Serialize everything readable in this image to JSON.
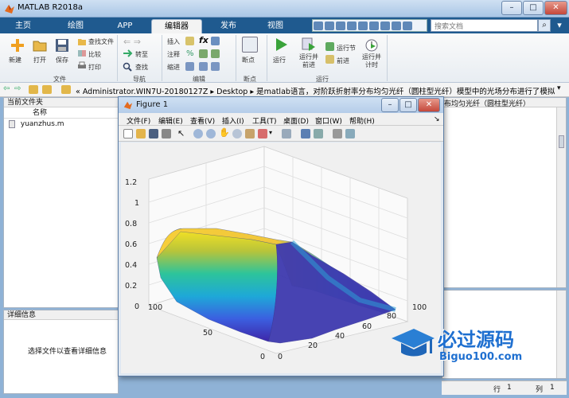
{
  "app": {
    "title": "MATLAB R2018a",
    "window_controls": {
      "minimize": "–",
      "maximize": "□",
      "close": "✕"
    }
  },
  "tabs": [
    {
      "label": "主页"
    },
    {
      "label": "绘图"
    },
    {
      "label": "APP"
    },
    {
      "label": "编辑器",
      "active": true
    },
    {
      "label": "发布"
    },
    {
      "label": "视图"
    }
  ],
  "search": {
    "placeholder": "搜索文档"
  },
  "ribbon": {
    "file_group": "文件",
    "nav_group": "导航",
    "edit_group": "编辑",
    "breakpoint_group": "断点",
    "run_group": "运行",
    "buttons": {
      "new": "新建",
      "open": "打开",
      "save": "保存",
      "find_files": "查找文件",
      "compare": "比较",
      "print": "打印",
      "goto": "转至",
      "find": "查找",
      "insert": "插入",
      "comment": "注释",
      "indent": "缩进",
      "breakpoints": "断点",
      "run": "运行",
      "run_advance": "运行并\n前进",
      "run_section": "运行节",
      "advance": "前进",
      "run_time": "运行并\n计时"
    }
  },
  "address": {
    "path": "« Administrator.WIN7U-20180127Z ▸ Desktop ▸ 是matlab语言，对阶跃折射率分布均匀光纤（圆柱型光纤）模型中的光场分布进行了模拟",
    "editor_tab": "布均匀光纤（圆柱型光纤）"
  },
  "file_panel": {
    "title": "当前文件夹",
    "name_header": "名称",
    "files": [
      "yuanzhus.m"
    ]
  },
  "detail_panel": {
    "title": "详细信息",
    "hint": "选择文件以查看详细信息"
  },
  "status": {
    "row_label": "行",
    "row": "1",
    "col_label": "列",
    "col": "1"
  },
  "figure": {
    "title": "Figure 1",
    "menus": [
      "文件(F)",
      "编辑(E)",
      "查看(V)",
      "插入(I)",
      "工具(T)",
      "桌面(D)",
      "窗口(W)",
      "帮助(H)"
    ]
  },
  "chart_data": {
    "type": "surface",
    "title": "",
    "xlabel": "",
    "ylabel": "",
    "zlabel": "",
    "x_range": [
      0,
      100
    ],
    "y_range": [
      0,
      100
    ],
    "zlim": [
      0,
      1.2
    ],
    "x_ticks": [
      0,
      20,
      40,
      60,
      80,
      100
    ],
    "y_ticks": [
      0,
      50,
      100
    ],
    "z_ticks": [
      0,
      0.2,
      0.4,
      0.6,
      0.8,
      1,
      1.2
    ],
    "colormap": "parula",
    "grid": true,
    "profile_along_x": [
      {
        "x": 0,
        "z": 0.95
      },
      {
        "x": 10,
        "z": 0.92
      },
      {
        "x": 20,
        "z": 0.86
      },
      {
        "x": 30,
        "z": 0.8
      },
      {
        "x": 40,
        "z": 0.72
      },
      {
        "x": 50,
        "z": 0.62
      },
      {
        "x": 60,
        "z": 0.4
      },
      {
        "x": 70,
        "z": 0.2
      },
      {
        "x": 80,
        "z": 0.08
      },
      {
        "x": 90,
        "z": 0.03
      },
      {
        "x": 100,
        "z": 0.01
      }
    ]
  },
  "watermark": {
    "text_cn": "必过源码",
    "text_en": "Biguo100.com"
  },
  "colors": {
    "ribbon_tab_bg": "#1f5a8f",
    "titlebar": "#b5cde9",
    "parula_low": "#3e26a8",
    "parula_high": "#f9fb0e"
  }
}
